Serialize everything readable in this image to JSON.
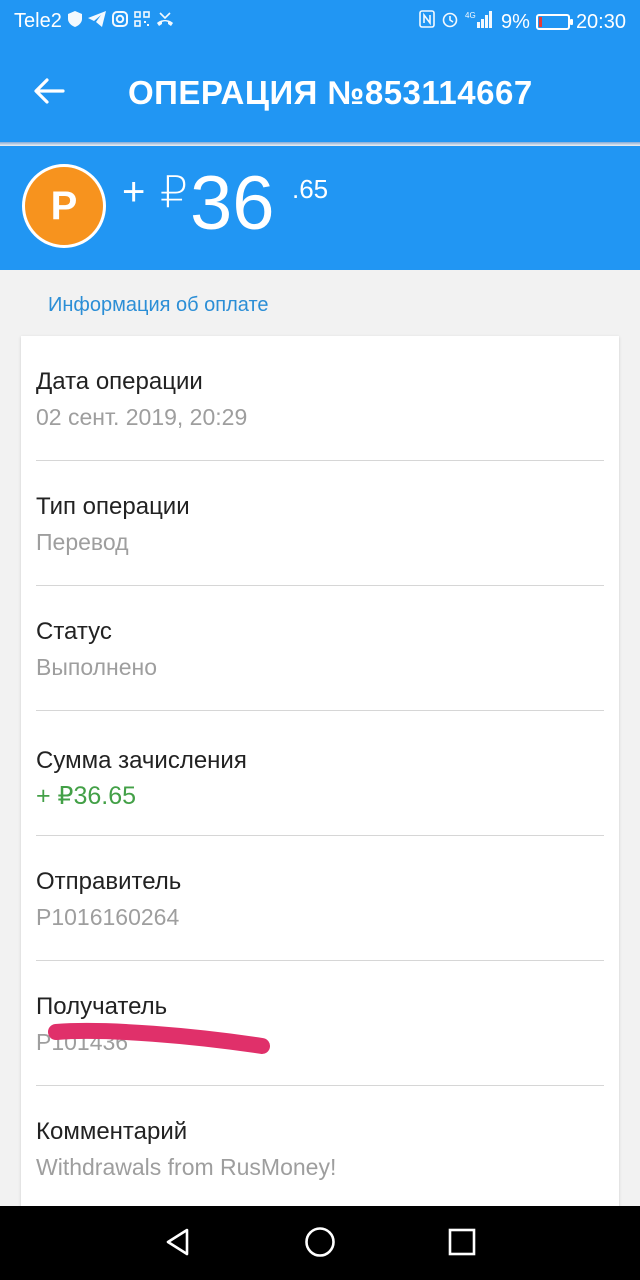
{
  "status_bar": {
    "carrier": "Tele2",
    "network": "4G",
    "battery_percent": "9%",
    "battery_level": 0.09,
    "time": "20:30",
    "icons_left": [
      "shield-icon",
      "telegram-icon",
      "instagram-icon",
      "qr-icon",
      "missed-call-icon"
    ],
    "icons_right": [
      "nfc-icon",
      "alarm-icon",
      "signal-icon",
      "battery-icon"
    ]
  },
  "app_bar": {
    "back_icon": "back-arrow-icon",
    "title": "ОПЕРАЦИЯ №853114667"
  },
  "amount": {
    "sign": "+",
    "currency_symbol": "₽",
    "integer": "36",
    "fraction": ".65",
    "coin_symbol": "Р",
    "coin_color": "#f7931e"
  },
  "section_title": "Информация об оплате",
  "rows": [
    {
      "label": "Дата операции",
      "value": "02 сент. 2019, 20:29"
    },
    {
      "label": "Тип операции",
      "value": "Перевод"
    },
    {
      "label": "Статус",
      "value": "Выполнено"
    },
    {
      "label": "Сумма зачисления",
      "value": "+ ₽36.65"
    },
    {
      "label": "Отправитель",
      "value": "P1016160264"
    },
    {
      "label": "Получатель",
      "value": "P101436"
    },
    {
      "label": "Комментарий",
      "value": "Withdrawals from RusMoney!"
    }
  ],
  "colors": {
    "primary": "#2196f3",
    "accent_link": "#2b8ed6",
    "positive": "#43a047",
    "redaction": "#e0306a"
  },
  "nav_bar": {
    "icons": [
      "nav-back-icon",
      "nav-home-icon",
      "nav-recents-icon"
    ]
  }
}
